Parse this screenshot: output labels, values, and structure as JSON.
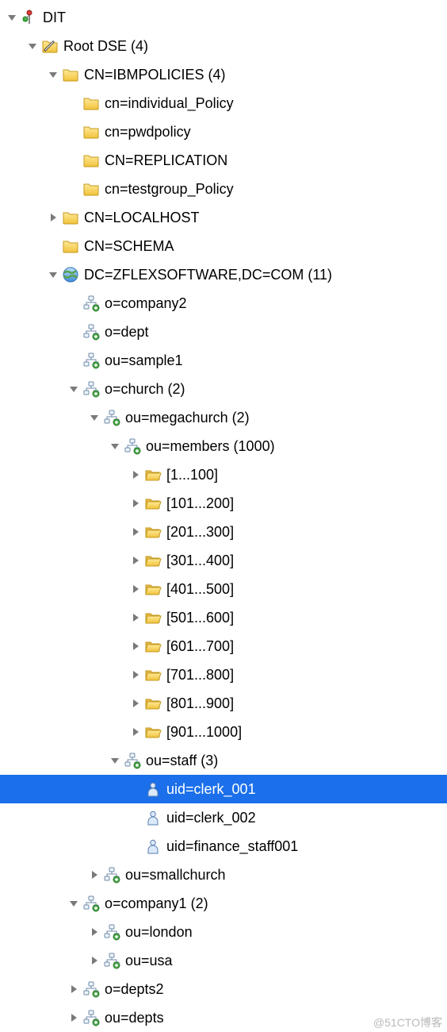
{
  "tree": {
    "indent_unit": 26,
    "rows": [
      {
        "depth": 0,
        "arrow": "down",
        "icon": "root",
        "label": "DIT",
        "selected": false
      },
      {
        "depth": 1,
        "arrow": "down",
        "icon": "rootdse",
        "label": "Root DSE (4)",
        "selected": false
      },
      {
        "depth": 2,
        "arrow": "down",
        "icon": "folder",
        "label": "CN=IBMPOLICIES (4)",
        "selected": false
      },
      {
        "depth": 3,
        "arrow": "none",
        "icon": "folder",
        "label": "cn=individual_Policy",
        "selected": false
      },
      {
        "depth": 3,
        "arrow": "none",
        "icon": "folder",
        "label": "cn=pwdpolicy",
        "selected": false
      },
      {
        "depth": 3,
        "arrow": "none",
        "icon": "folder",
        "label": "CN=REPLICATION",
        "selected": false
      },
      {
        "depth": 3,
        "arrow": "none",
        "icon": "folder",
        "label": "cn=testgroup_Policy",
        "selected": false
      },
      {
        "depth": 2,
        "arrow": "right",
        "icon": "folder",
        "label": "CN=LOCALHOST",
        "selected": false
      },
      {
        "depth": 2,
        "arrow": "none",
        "icon": "folder",
        "label": "CN=SCHEMA",
        "selected": false
      },
      {
        "depth": 2,
        "arrow": "down",
        "icon": "globe",
        "label": "DC=ZFLEXSOFTWARE,DC=COM (11)",
        "selected": false
      },
      {
        "depth": 3,
        "arrow": "none",
        "icon": "ou",
        "label": "o=company2",
        "selected": false
      },
      {
        "depth": 3,
        "arrow": "none",
        "icon": "ou",
        "label": "o=dept",
        "selected": false
      },
      {
        "depth": 3,
        "arrow": "none",
        "icon": "ou",
        "label": "ou=sample1",
        "selected": false
      },
      {
        "depth": 3,
        "arrow": "down",
        "icon": "ou",
        "label": "o=church (2)",
        "selected": false
      },
      {
        "depth": 4,
        "arrow": "down",
        "icon": "ou",
        "label": "ou=megachurch (2)",
        "selected": false
      },
      {
        "depth": 5,
        "arrow": "down",
        "icon": "ou",
        "label": "ou=members (1000)",
        "selected": false
      },
      {
        "depth": 6,
        "arrow": "right",
        "icon": "folderopen",
        "label": "[1...100]",
        "selected": false
      },
      {
        "depth": 6,
        "arrow": "right",
        "icon": "folderopen",
        "label": "[101...200]",
        "selected": false
      },
      {
        "depth": 6,
        "arrow": "right",
        "icon": "folderopen",
        "label": "[201...300]",
        "selected": false
      },
      {
        "depth": 6,
        "arrow": "right",
        "icon": "folderopen",
        "label": "[301...400]",
        "selected": false
      },
      {
        "depth": 6,
        "arrow": "right",
        "icon": "folderopen",
        "label": "[401...500]",
        "selected": false
      },
      {
        "depth": 6,
        "arrow": "right",
        "icon": "folderopen",
        "label": "[501...600]",
        "selected": false
      },
      {
        "depth": 6,
        "arrow": "right",
        "icon": "folderopen",
        "label": "[601...700]",
        "selected": false
      },
      {
        "depth": 6,
        "arrow": "right",
        "icon": "folderopen",
        "label": "[701...800]",
        "selected": false
      },
      {
        "depth": 6,
        "arrow": "right",
        "icon": "folderopen",
        "label": "[801...900]",
        "selected": false
      },
      {
        "depth": 6,
        "arrow": "right",
        "icon": "folderopen",
        "label": "[901...1000]",
        "selected": false
      },
      {
        "depth": 5,
        "arrow": "down",
        "icon": "ou",
        "label": "ou=staff (3)",
        "selected": false
      },
      {
        "depth": 6,
        "arrow": "none",
        "icon": "person",
        "label": "uid=clerk_001",
        "selected": true
      },
      {
        "depth": 6,
        "arrow": "none",
        "icon": "person",
        "label": "uid=clerk_002",
        "selected": false
      },
      {
        "depth": 6,
        "arrow": "none",
        "icon": "person",
        "label": "uid=finance_staff001",
        "selected": false
      },
      {
        "depth": 4,
        "arrow": "right",
        "icon": "ou",
        "label": "ou=smallchurch",
        "selected": false
      },
      {
        "depth": 3,
        "arrow": "down",
        "icon": "ou",
        "label": "o=company1 (2)",
        "selected": false
      },
      {
        "depth": 4,
        "arrow": "right",
        "icon": "ou",
        "label": "ou=london",
        "selected": false
      },
      {
        "depth": 4,
        "arrow": "right",
        "icon": "ou",
        "label": "ou=usa",
        "selected": false
      },
      {
        "depth": 3,
        "arrow": "right",
        "icon": "ou",
        "label": "o=depts2",
        "selected": false
      },
      {
        "depth": 3,
        "arrow": "right",
        "icon": "ou",
        "label": "ou=depts",
        "selected": false
      }
    ]
  },
  "watermark": "@51CTO博客"
}
